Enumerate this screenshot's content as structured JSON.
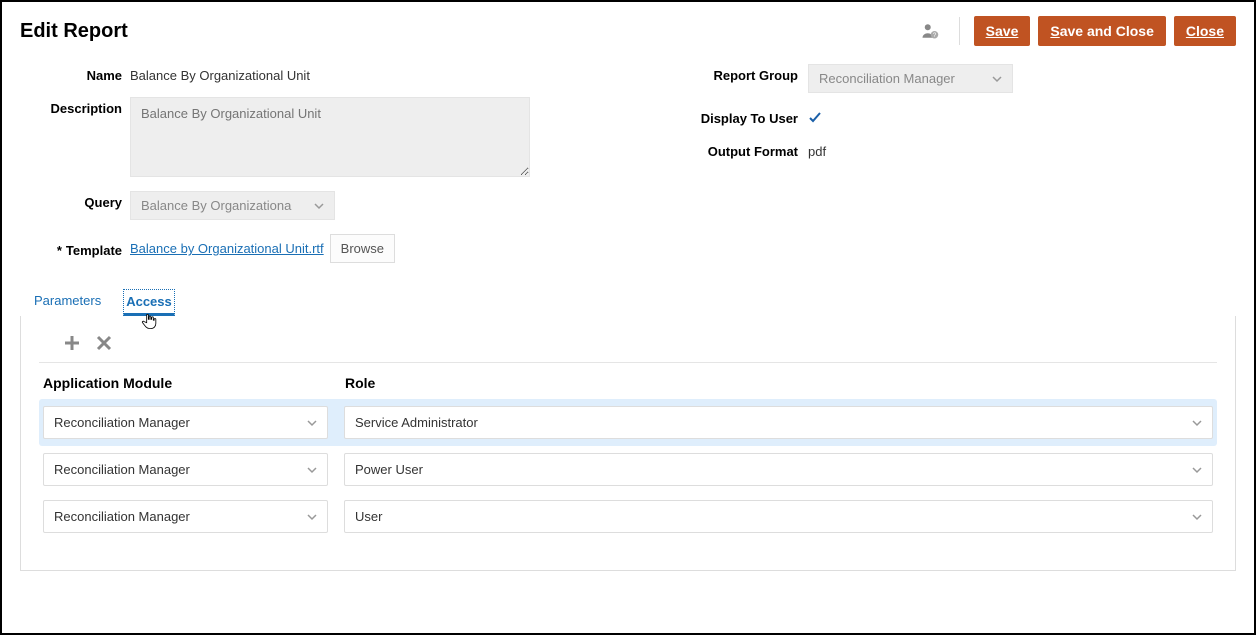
{
  "header": {
    "title": "Edit Report",
    "save": "Save",
    "save_close": "Save and Close",
    "close": "Close"
  },
  "form": {
    "name_label": "Name",
    "name_value": "Balance By Organizational Unit",
    "desc_label": "Description",
    "desc_placeholder": "Balance By Organizational Unit",
    "query_label": "Query",
    "query_value": "Balance By Organizationa",
    "template_label": "Template",
    "template_file": "Balance by Organizational Unit.rtf",
    "browse_label": "Browse",
    "report_group_label": "Report Group",
    "report_group_value": "Reconciliation Manager",
    "display_user_label": "Display To User",
    "output_format_label": "Output Format",
    "output_format_value": "pdf"
  },
  "tabs": {
    "parameters": "Parameters",
    "access": "Access"
  },
  "access": {
    "col_module": "Application Module",
    "col_role": "Role",
    "rows": [
      {
        "module": "Reconciliation Manager",
        "role": "Service Administrator"
      },
      {
        "module": "Reconciliation Manager",
        "role": "Power User"
      },
      {
        "module": "Reconciliation Manager",
        "role": "User"
      }
    ]
  }
}
